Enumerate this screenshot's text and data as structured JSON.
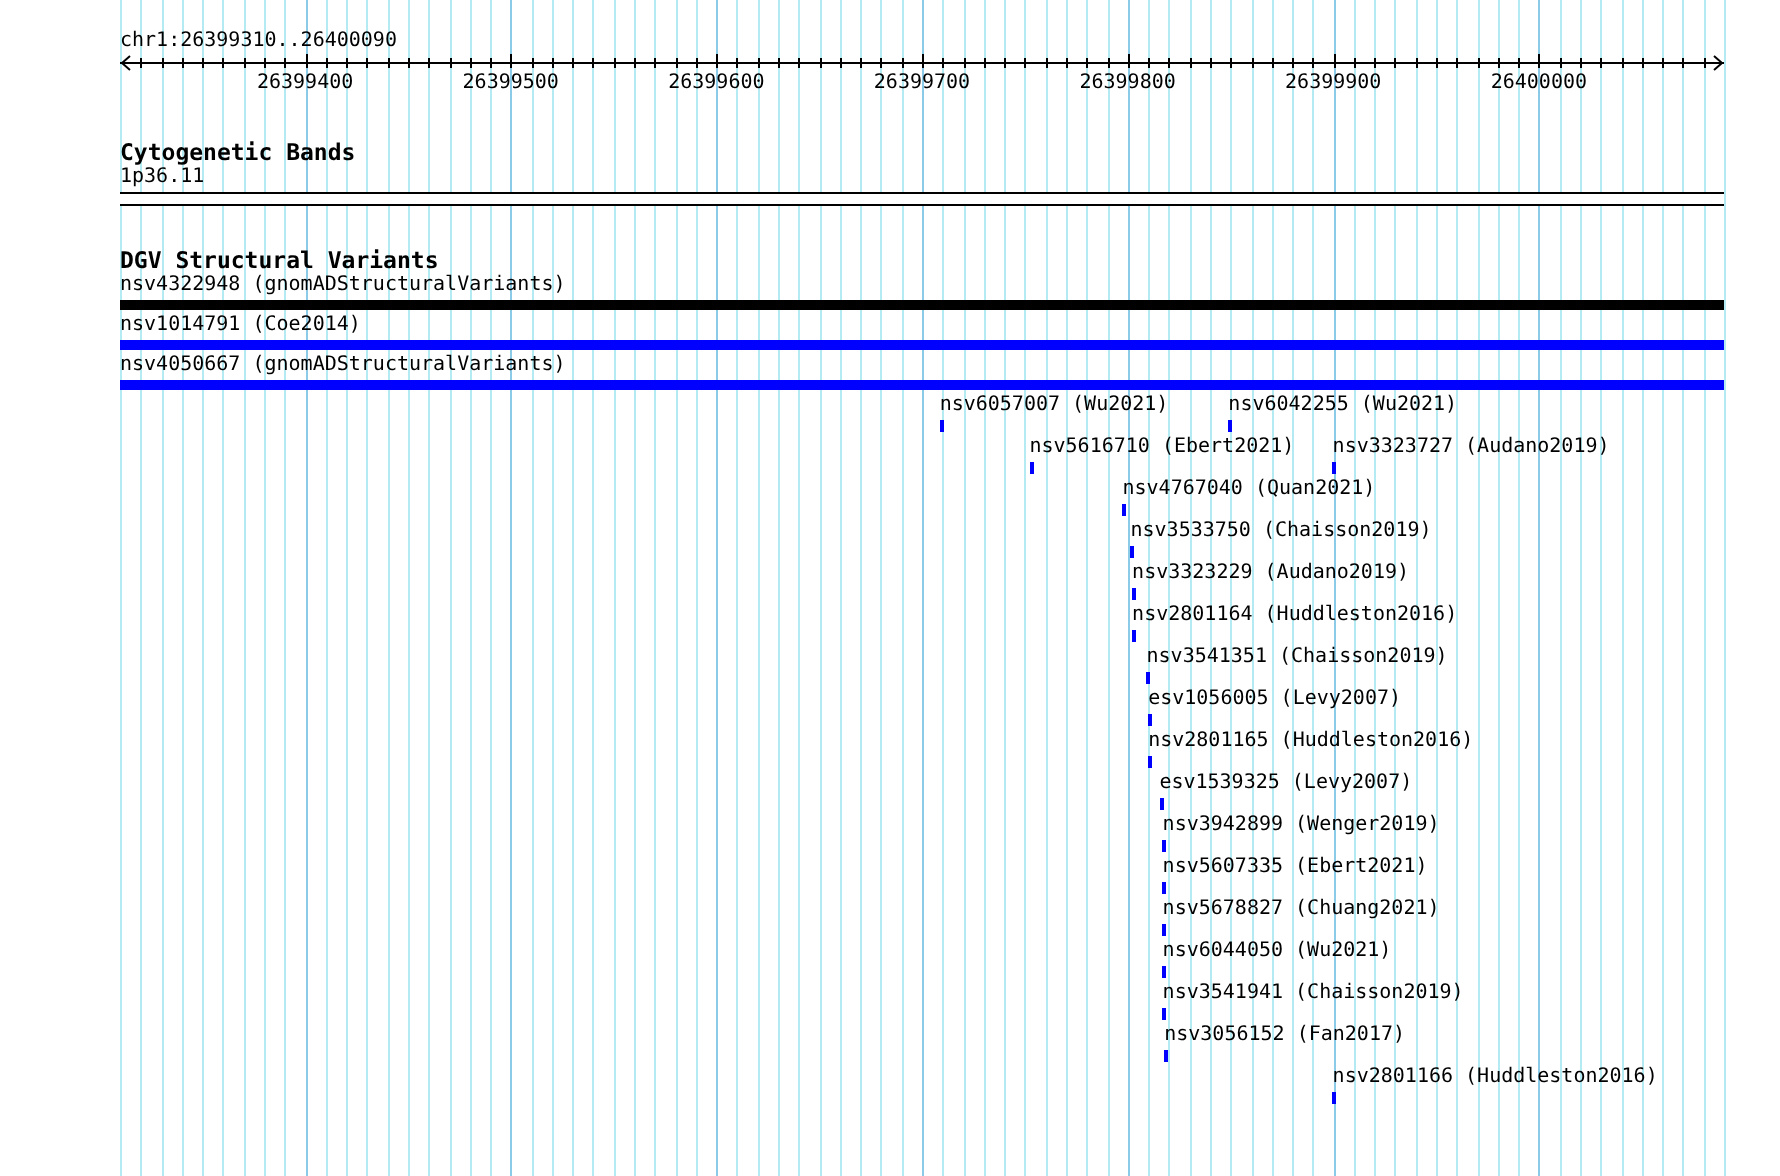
{
  "ruler": {
    "location": "chr1:26399310..26400090",
    "ticks": [
      {
        "label": "26399400",
        "level": 0.1154
      },
      {
        "label": "26399500",
        "level": 0.2436
      },
      {
        "label": "26399600",
        "level": 0.3718
      },
      {
        "label": "26399700",
        "level": 0.5
      },
      {
        "label": "26399800",
        "level": 0.6282
      },
      {
        "label": "26399900",
        "level": 0.7564
      },
      {
        "label": "26400000",
        "level": 0.8846
      }
    ]
  },
  "tracks": [
    {
      "kind": "bands",
      "title": "Cytogenetic Bands",
      "bands": [
        {
          "label": "1p36.11"
        }
      ]
    },
    {
      "kind": "features",
      "title": "DGV Structural Variants",
      "rows": [
        {
          "features": [
            {
              "kind": "span",
              "label": "nsv4322948 (gnomADStructuralVariants)",
              "color": "#000000"
            }
          ]
        },
        {
          "features": [
            {
              "kind": "span",
              "label": "nsv1014791 (Coe2014)",
              "color": "#0000ff"
            }
          ]
        },
        {
          "features": [
            {
              "kind": "span",
              "label": "nsv4050667 (gnomADStructuralVariants)",
              "color": "#0000ff"
            }
          ]
        },
        {
          "features": [
            {
              "kind": "point",
              "label": "nsv6057007 (Wu2021)",
              "color": "#0000ff",
              "level": 0.511
            },
            {
              "kind": "point",
              "label": "nsv6042255 (Wu2021)",
              "color": "#0000ff",
              "level": 0.691
            }
          ]
        },
        {
          "features": [
            {
              "kind": "point",
              "label": "nsv5616710 (Ebert2021)",
              "color": "#0000ff",
              "level": 0.567
            },
            {
              "kind": "point",
              "label": "nsv3323727 (Audano2019)",
              "color": "#0000ff",
              "level": 0.756
            }
          ]
        },
        {
          "features": [
            {
              "kind": "point",
              "label": "nsv4767040 (Quan2021)",
              "color": "#0000ff",
              "level": 0.625
            }
          ]
        },
        {
          "features": [
            {
              "kind": "point",
              "label": "nsv3533750 (Chaisson2019)",
              "color": "#0000ff",
              "level": 0.63
            }
          ]
        },
        {
          "features": [
            {
              "kind": "point",
              "label": "nsv3323229 (Audano2019)",
              "color": "#0000ff",
              "level": 0.631
            }
          ]
        },
        {
          "features": [
            {
              "kind": "point",
              "label": "nsv2801164 (Huddleston2016)",
              "color": "#0000ff",
              "level": 0.631
            }
          ]
        },
        {
          "features": [
            {
              "kind": "point",
              "label": "nsv3541351 (Chaisson2019)",
              "color": "#0000ff",
              "level": 0.64
            }
          ]
        },
        {
          "features": [
            {
              "kind": "point",
              "label": "esv1056005 (Levy2007)",
              "color": "#0000ff",
              "level": 0.641
            }
          ]
        },
        {
          "features": [
            {
              "kind": "point",
              "label": "nsv2801165 (Huddleston2016)",
              "color": "#0000ff",
              "level": 0.641
            }
          ]
        },
        {
          "features": [
            {
              "kind": "point",
              "label": "esv1539325 (Levy2007)",
              "color": "#0000ff",
              "level": 0.648
            }
          ]
        },
        {
          "features": [
            {
              "kind": "point",
              "label": "nsv3942899 (Wenger2019)",
              "color": "#0000ff",
              "level": 0.65
            }
          ]
        },
        {
          "features": [
            {
              "kind": "point",
              "label": "nsv5607335 (Ebert2021)",
              "color": "#0000ff",
              "level": 0.65
            }
          ]
        },
        {
          "features": [
            {
              "kind": "point",
              "label": "nsv5678827 (Chuang2021)",
              "color": "#0000ff",
              "level": 0.65
            }
          ]
        },
        {
          "features": [
            {
              "kind": "point",
              "label": "nsv6044050 (Wu2021)",
              "color": "#0000ff",
              "level": 0.65
            }
          ]
        },
        {
          "features": [
            {
              "kind": "point",
              "label": "nsv3541941 (Chaisson2019)",
              "color": "#0000ff",
              "level": 0.65
            }
          ]
        },
        {
          "features": [
            {
              "kind": "point",
              "label": "nsv3056152 (Fan2017)",
              "color": "#0000ff",
              "level": 0.651
            }
          ]
        },
        {
          "features": [
            {
              "kind": "point",
              "label": "nsv2801166 (Huddleston2016)",
              "color": "#0000ff",
              "level": 0.756
            }
          ]
        }
      ]
    }
  ]
}
